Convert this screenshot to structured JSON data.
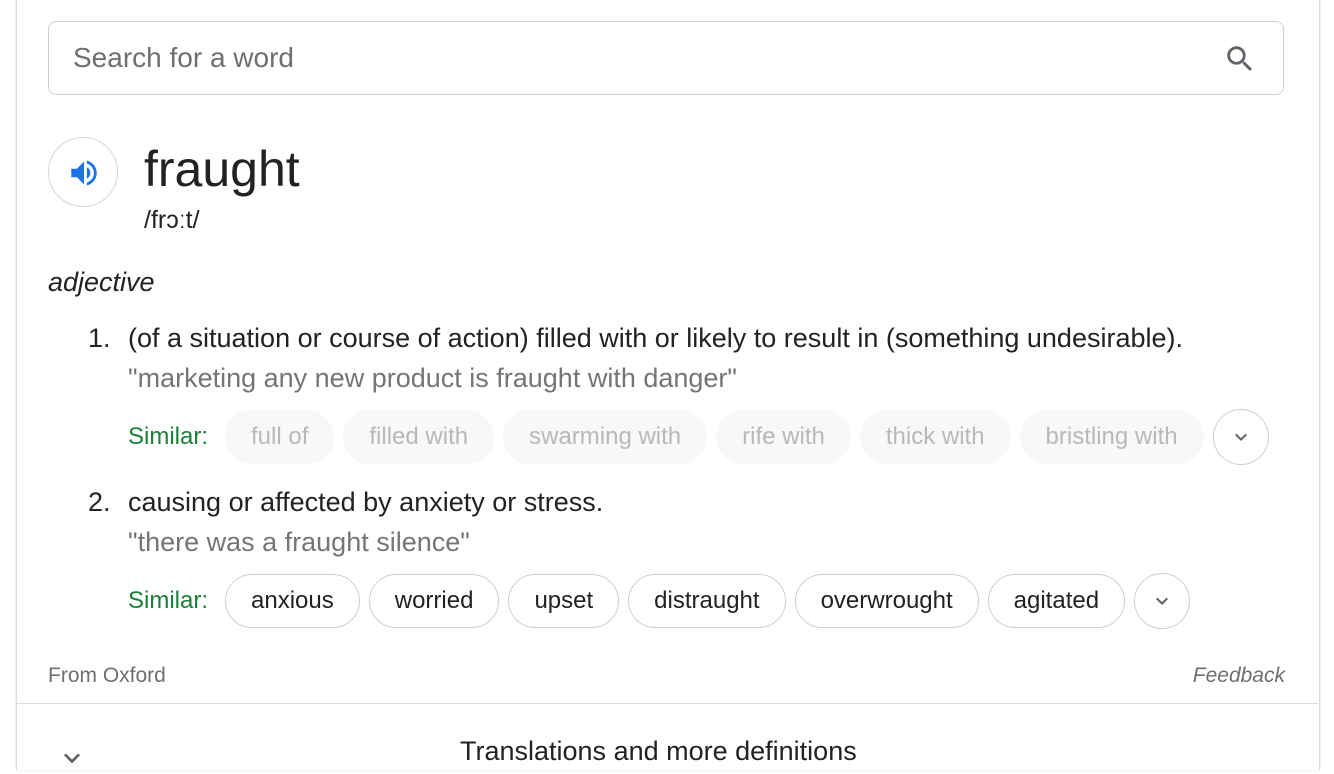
{
  "search": {
    "placeholder": "Search for a word",
    "value": ""
  },
  "entry": {
    "word": "fraught",
    "phonetic": "/frɔːt/",
    "part_of_speech": "adjective"
  },
  "definitions": [
    {
      "number": "1.",
      "text": "(of a situation or course of action) filled with or likely to result in (something undesirable).",
      "example": "\"marketing any new product is fraught with danger\"",
      "similar_label": "Similar:",
      "similar": [
        "full of",
        "filled with",
        "swarming with",
        "rife with",
        "thick with",
        "bristling with"
      ],
      "similar_state": "disabled"
    },
    {
      "number": "2.",
      "text": "causing or affected by anxiety or stress.",
      "example": "\"there was a fraught silence\"",
      "similar_label": "Similar:",
      "similar": [
        "anxious",
        "worried",
        "upset",
        "distraught",
        "overwrought",
        "agitated"
      ],
      "similar_state": "active"
    }
  ],
  "footer": {
    "source": "From Oxford",
    "feedback": "Feedback"
  },
  "more": {
    "label": "Translations and more definitions"
  },
  "colors": {
    "accent_blue": "#1a73e8",
    "similar_green": "#188038",
    "muted_text": "#757575"
  },
  "icons": {
    "search": "search-icon",
    "speaker": "speaker-icon",
    "expand": "chevron-down-icon"
  }
}
